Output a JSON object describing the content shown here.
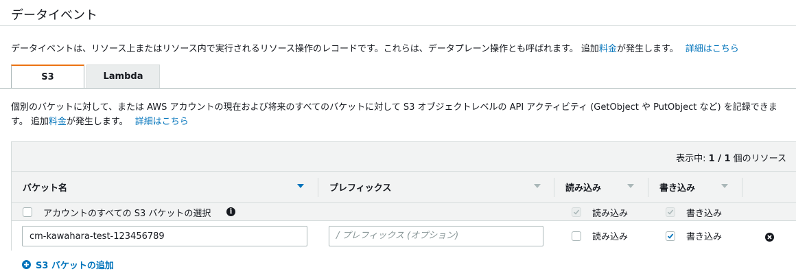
{
  "section": {
    "title": "データイベント",
    "description_prefix": "データイベントは、リソース上またはリソース内で実行されるリソース操作のレコードです。これらは、データプレーン操作とも呼ばれます。 追加",
    "pricing_link": "料金",
    "description_suffix": "が発生します。",
    "details_link": "詳細はこちら"
  },
  "tabs": [
    {
      "label": "S3",
      "active": true
    },
    {
      "label": "Lambda",
      "active": false
    }
  ],
  "s3": {
    "description_prefix": "個別のバケットに対して、または AWS アカウントの現在および将来のすべてのバケットに対して S3 オブジェクトレベルの API アクティビティ (GetObject や PutObject など) を記録できます。 追加",
    "pricing_link": "料金",
    "description_suffix": "が発生します。",
    "details_link": "詳細はこちら"
  },
  "table": {
    "count_prefix": "表示中: ",
    "count_value": "1 / 1",
    "count_suffix": " 個のリソース",
    "columns": [
      "バケット名",
      "プレフィックス",
      "読み込み",
      "書き込み"
    ],
    "all_buckets_row": {
      "label": "アカウントのすべての S3 バケットの選択",
      "read_label": "読み込み",
      "write_label": "書き込み",
      "selected": false,
      "read_checked": true,
      "write_checked": true
    },
    "bucket_row": {
      "bucket_name": "cm-kawahara-test-123456789",
      "prefix_placeholder": "/ プレフィックス (オプション)",
      "read_label": "読み込み",
      "write_label": "書き込み",
      "read_checked": false,
      "write_checked": true
    }
  },
  "add_bucket_label": "S3 バケットの追加",
  "colors": {
    "link": "#0073bb",
    "active_tab_accent": "#ec7211",
    "header_bg": "#f2f3f3"
  }
}
